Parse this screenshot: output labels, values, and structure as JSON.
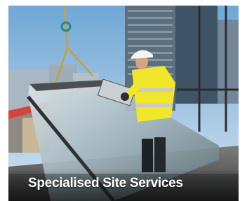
{
  "banner": {
    "caption": "Specialised Site Services"
  },
  "photo": {
    "subject": "worker-in-hi-vis-guiding-crane-lifted-glass-panel",
    "accent_color": "#f2e62a",
    "helmet_color": "#f4f4f4"
  }
}
